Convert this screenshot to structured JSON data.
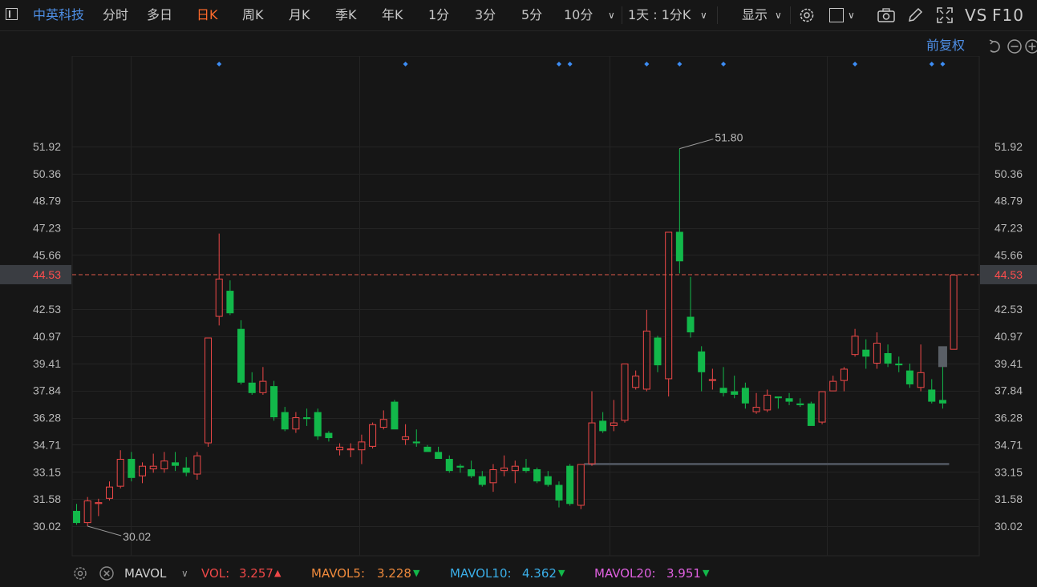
{
  "toolbar": {
    "stock_name": "中英科技",
    "tabs": [
      "分时",
      "多日",
      "日K",
      "周K",
      "月K",
      "季K",
      "年K",
      "1分",
      "3分",
      "5分",
      "10分"
    ],
    "active_tab": "日K",
    "period_selector": "1天 : 1分K",
    "display_label": "显示",
    "vs_label": "VS",
    "f10_label": "F10"
  },
  "subheader": {
    "adjust_label": "前复权"
  },
  "price_axis": {
    "ticks": [
      "51.92",
      "50.36",
      "48.79",
      "47.23",
      "45.66",
      "42.53",
      "40.97",
      "39.41",
      "37.84",
      "36.28",
      "34.71",
      "33.15",
      "31.58",
      "30.02"
    ],
    "current_price": "44.53",
    "high_label": "51.80",
    "low_label": "30.02"
  },
  "chart_data": {
    "type": "candlestick",
    "y_range": [
      29.0,
      53.3
    ],
    "up_color": "#f04848",
    "down_color": "#12b84a",
    "current_price": 44.53,
    "candles": [
      {
        "o": 30.9,
        "h": 31.3,
        "l": 30.1,
        "c": 30.2
      },
      {
        "o": 30.2,
        "h": 31.7,
        "l": 30.02,
        "c": 31.5
      },
      {
        "o": 31.3,
        "h": 31.6,
        "l": 30.6,
        "c": 31.4
      },
      {
        "o": 31.6,
        "h": 32.6,
        "l": 31.5,
        "c": 32.3
      },
      {
        "o": 32.3,
        "h": 34.4,
        "l": 32.2,
        "c": 33.9
      },
      {
        "o": 33.9,
        "h": 34.3,
        "l": 32.6,
        "c": 32.8
      },
      {
        "o": 32.9,
        "h": 33.7,
        "l": 32.5,
        "c": 33.5
      },
      {
        "o": 33.3,
        "h": 34.2,
        "l": 33.1,
        "c": 33.5
      },
      {
        "o": 33.3,
        "h": 34.3,
        "l": 33.1,
        "c": 33.8
      },
      {
        "o": 33.7,
        "h": 34.3,
        "l": 33.2,
        "c": 33.5
      },
      {
        "o": 33.4,
        "h": 34.0,
        "l": 32.9,
        "c": 33.1
      },
      {
        "o": 33.0,
        "h": 34.3,
        "l": 32.7,
        "c": 34.1
      },
      {
        "o": 34.8,
        "h": 40.9,
        "l": 34.6,
        "c": 40.9
      },
      {
        "o": 42.1,
        "h": 46.9,
        "l": 41.6,
        "c": 44.3
      },
      {
        "o": 43.6,
        "h": 44.2,
        "l": 42.2,
        "c": 42.3
      },
      {
        "o": 41.4,
        "h": 41.9,
        "l": 38.2,
        "c": 38.3
      },
      {
        "o": 38.3,
        "h": 38.9,
        "l": 37.6,
        "c": 37.7
      },
      {
        "o": 37.7,
        "h": 39.2,
        "l": 37.6,
        "c": 38.4
      },
      {
        "o": 38.1,
        "h": 38.4,
        "l": 36.1,
        "c": 36.3
      },
      {
        "o": 36.6,
        "h": 36.9,
        "l": 35.5,
        "c": 35.6
      },
      {
        "o": 35.6,
        "h": 36.6,
        "l": 35.4,
        "c": 36.3
      },
      {
        "o": 36.3,
        "h": 36.8,
        "l": 35.8,
        "c": 36.2
      },
      {
        "o": 36.6,
        "h": 36.8,
        "l": 35.0,
        "c": 35.2
      },
      {
        "o": 35.4,
        "h": 35.5,
        "l": 34.9,
        "c": 35.1
      },
      {
        "o": 34.4,
        "h": 34.8,
        "l": 34.1,
        "c": 34.6
      },
      {
        "o": 34.4,
        "h": 34.8,
        "l": 34.0,
        "c": 34.5
      },
      {
        "o": 34.4,
        "h": 35.3,
        "l": 33.6,
        "c": 34.9
      },
      {
        "o": 34.6,
        "h": 36.0,
        "l": 34.5,
        "c": 35.9
      },
      {
        "o": 35.7,
        "h": 36.7,
        "l": 35.6,
        "c": 36.2
      },
      {
        "o": 37.2,
        "h": 37.3,
        "l": 35.6,
        "c": 35.6
      },
      {
        "o": 35.0,
        "h": 35.9,
        "l": 34.7,
        "c": 35.2
      },
      {
        "o": 34.9,
        "h": 35.6,
        "l": 34.6,
        "c": 34.8
      },
      {
        "o": 34.6,
        "h": 34.7,
        "l": 34.3,
        "c": 34.3
      },
      {
        "o": 34.3,
        "h": 34.6,
        "l": 33.9,
        "c": 33.9
      },
      {
        "o": 33.9,
        "h": 34.1,
        "l": 33.1,
        "c": 33.2
      },
      {
        "o": 33.5,
        "h": 33.6,
        "l": 33.1,
        "c": 33.4
      },
      {
        "o": 33.3,
        "h": 33.8,
        "l": 32.8,
        "c": 32.9
      },
      {
        "o": 32.9,
        "h": 33.2,
        "l": 32.3,
        "c": 32.4
      },
      {
        "o": 32.5,
        "h": 33.6,
        "l": 32.0,
        "c": 33.3
      },
      {
        "o": 33.2,
        "h": 34.1,
        "l": 32.9,
        "c": 33.4
      },
      {
        "o": 33.2,
        "h": 33.8,
        "l": 32.5,
        "c": 33.5
      },
      {
        "o": 33.4,
        "h": 33.9,
        "l": 33.1,
        "c": 33.2
      },
      {
        "o": 33.3,
        "h": 33.4,
        "l": 32.5,
        "c": 32.6
      },
      {
        "o": 32.9,
        "h": 33.2,
        "l": 32.3,
        "c": 32.4
      },
      {
        "o": 32.4,
        "h": 32.6,
        "l": 31.1,
        "c": 31.5
      },
      {
        "o": 33.5,
        "h": 33.6,
        "l": 31.2,
        "c": 31.3
      },
      {
        "o": 31.2,
        "h": 33.6,
        "l": 31.0,
        "c": 33.6
      },
      {
        "o": 33.6,
        "h": 37.8,
        "l": 33.5,
        "c": 36.0
      },
      {
        "o": 36.1,
        "h": 36.6,
        "l": 35.4,
        "c": 35.5
      },
      {
        "o": 35.8,
        "h": 37.3,
        "l": 35.5,
        "c": 36.0
      },
      {
        "o": 36.1,
        "h": 39.4,
        "l": 36.0,
        "c": 39.4
      },
      {
        "o": 38.0,
        "h": 39.0,
        "l": 37.9,
        "c": 38.7
      },
      {
        "o": 37.9,
        "h": 42.5,
        "l": 37.8,
        "c": 41.3
      },
      {
        "o": 40.9,
        "h": 41.0,
        "l": 38.9,
        "c": 39.3
      },
      {
        "o": 38.5,
        "h": 47.0,
        "l": 37.5,
        "c": 47.0
      },
      {
        "o": 47.0,
        "h": 51.8,
        "l": 44.6,
        "c": 45.3
      },
      {
        "o": 42.1,
        "h": 44.4,
        "l": 40.9,
        "c": 41.2
      },
      {
        "o": 40.1,
        "h": 40.4,
        "l": 37.8,
        "c": 38.9
      },
      {
        "o": 38.4,
        "h": 39.1,
        "l": 37.9,
        "c": 38.5
      },
      {
        "o": 38.0,
        "h": 39.2,
        "l": 37.5,
        "c": 37.7
      },
      {
        "o": 37.8,
        "h": 38.7,
        "l": 37.4,
        "c": 37.6
      },
      {
        "o": 38.0,
        "h": 38.3,
        "l": 36.8,
        "c": 37.1
      },
      {
        "o": 36.6,
        "h": 37.7,
        "l": 36.5,
        "c": 36.9
      },
      {
        "o": 36.7,
        "h": 37.9,
        "l": 36.6,
        "c": 37.6
      },
      {
        "o": 37.5,
        "h": 37.5,
        "l": 36.8,
        "c": 37.4
      },
      {
        "o": 37.4,
        "h": 37.7,
        "l": 37.0,
        "c": 37.2
      },
      {
        "o": 37.1,
        "h": 37.4,
        "l": 36.9,
        "c": 37.0
      },
      {
        "o": 37.1,
        "h": 37.2,
        "l": 35.8,
        "c": 35.8
      },
      {
        "o": 36.0,
        "h": 37.7,
        "l": 35.9,
        "c": 37.8
      },
      {
        "o": 37.8,
        "h": 38.7,
        "l": 37.8,
        "c": 38.4
      },
      {
        "o": 38.4,
        "h": 39.2,
        "l": 37.8,
        "c": 39.1
      },
      {
        "o": 39.9,
        "h": 41.4,
        "l": 39.8,
        "c": 41.0
      },
      {
        "o": 40.2,
        "h": 40.8,
        "l": 39.1,
        "c": 39.8
      },
      {
        "o": 39.4,
        "h": 41.2,
        "l": 39.1,
        "c": 40.6
      },
      {
        "o": 40.0,
        "h": 40.5,
        "l": 39.2,
        "c": 39.4
      },
      {
        "o": 39.4,
        "h": 39.8,
        "l": 38.9,
        "c": 39.3
      },
      {
        "o": 39.0,
        "h": 39.4,
        "l": 38.0,
        "c": 38.2
      },
      {
        "o": 38.0,
        "h": 40.5,
        "l": 37.8,
        "c": 38.9
      },
      {
        "o": 37.9,
        "h": 38.5,
        "l": 37.1,
        "c": 37.2
      },
      {
        "o": 37.3,
        "h": 39.3,
        "l": 36.8,
        "c": 37.1
      },
      {
        "o": 40.2,
        "h": 44.53,
        "l": 40.2,
        "c": 44.53
      }
    ],
    "markers_at": [
      13,
      30,
      44,
      45,
      52,
      55,
      59,
      71,
      78,
      79
    ],
    "flat_line": {
      "from": 46,
      "to": 79,
      "value": 33.6
    },
    "gray_block": {
      "index": 79,
      "low": 39.2,
      "high": 40.4
    }
  },
  "footer": {
    "indicator": "MAVOL",
    "vol_label": "VOL:",
    "vol_value": "3.257",
    "mavol5_label": "MAVOL5:",
    "mavol5_value": "3.228",
    "mavol10_label": "MAVOL10:",
    "mavol10_value": "4.362",
    "mavol20_label": "MAVOL20:",
    "mavol20_value": "3.951",
    "colors": {
      "vol": "#f04848",
      "mavol5": "#f08a3c",
      "mavol10": "#3aaee8",
      "mavol20": "#e060e0"
    }
  }
}
